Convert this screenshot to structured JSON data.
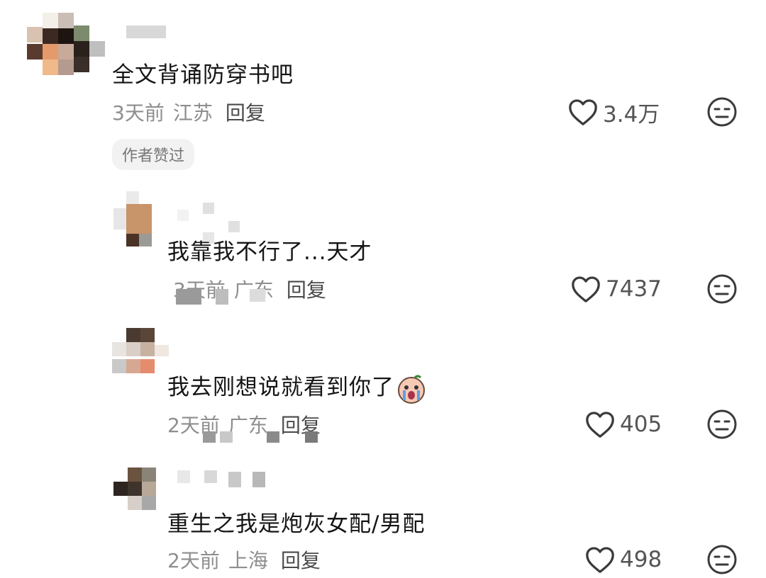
{
  "comments": [
    {
      "text": "全文背诵防穿书吧",
      "time": "3天前",
      "location": "江苏",
      "reply_label": "回复",
      "likes": "3.4万",
      "badge": "作者赞过",
      "like_icon": "heart-outline-icon",
      "dislike_icon": "unamused-face-icon"
    },
    {
      "text": "我靠我不行了...天才",
      "time": "3天前",
      "location": "广东",
      "reply_label": "回复",
      "likes": "7437",
      "like_icon": "heart-outline-icon",
      "dislike_icon": "unamused-face-icon"
    },
    {
      "text": "我去刚想说就看到你了",
      "emoji": "crying-face-emoji",
      "time": "2天前",
      "location": "广东",
      "reply_label": "回复",
      "likes": "405",
      "like_icon": "heart-outline-icon",
      "dislike_icon": "unamused-face-icon"
    },
    {
      "text": "重生之我是炮灰女配/男配",
      "time": "2天前",
      "location": "上海",
      "reply_label": "回复",
      "likes": "498",
      "like_icon": "heart-outline-icon",
      "dislike_icon": "unamused-face-icon"
    }
  ],
  "colors": {
    "text": "#151515",
    "meta": "#8e8e8e",
    "reply": "#4a4a4a",
    "icon": "#3a3a3a",
    "badge_bg": "#f2f2f2"
  }
}
